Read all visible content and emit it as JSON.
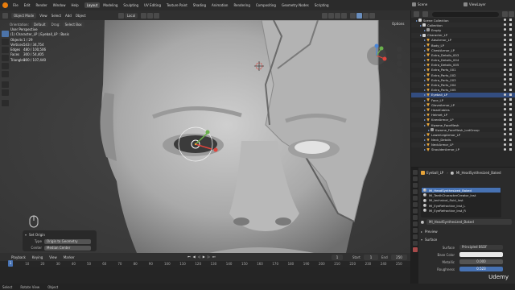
{
  "topbar": {
    "menus": [
      "File",
      "Edit",
      "Render",
      "Window",
      "Help"
    ],
    "workspaces": [
      {
        "label": "Layout",
        "active": true
      },
      {
        "label": "Modeling",
        "active": false
      },
      {
        "label": "Sculpting",
        "active": false
      },
      {
        "label": "UV Editing",
        "active": false
      },
      {
        "label": "Texture Paint",
        "active": false
      },
      {
        "label": "Shading",
        "active": false
      },
      {
        "label": "Animation",
        "active": false
      },
      {
        "label": "Rendering",
        "active": false
      },
      {
        "label": "Compositing",
        "active": false
      },
      {
        "label": "Geometry Nodes",
        "active": false
      },
      {
        "label": "Scripting",
        "active": false
      }
    ],
    "scene": "Scene",
    "view_layer": "ViewLayer"
  },
  "viewport_header": {
    "mode": "Object Mode",
    "menus": [
      "View",
      "Select",
      "Add",
      "Object"
    ],
    "transform": "Local",
    "orientation_label": "Orientation:",
    "orientation_value": "Default",
    "drag_label": "Drag:",
    "drag_value": "Select Box",
    "options": "Options"
  },
  "stats": {
    "perspective": "User Perspective",
    "object": "(1) Character_LP | Eyeball_LP : Basis",
    "rows": [
      {
        "key": "Objects",
        "value": "1 / 29"
      },
      {
        "key": "Vertices",
        "value": "543 / 34,754"
      },
      {
        "key": "Edges",
        "value": "480 / 100,506"
      },
      {
        "key": "Faces",
        "value": "300 / 54,405"
      },
      {
        "key": "Triangles",
        "value": "300 / 107,440"
      }
    ]
  },
  "last_operator": {
    "title": "Set Origin",
    "rows": [
      {
        "label": "Type",
        "value": "Origin to Geometry"
      },
      {
        "label": "Center",
        "value": "Median Center"
      }
    ]
  },
  "timeline": {
    "menus": [
      "Playback",
      "Keying",
      "View",
      "Marker"
    ],
    "current_frame": "1",
    "start_label": "Start",
    "start": "1",
    "end_label": "End",
    "end": "250",
    "ruler": [
      "0",
      "10",
      "20",
      "30",
      "40",
      "50",
      "60",
      "70",
      "80",
      "90",
      "100",
      "110",
      "120",
      "130",
      "140",
      "150",
      "160",
      "170",
      "180",
      "190",
      "200",
      "210",
      "220",
      "230",
      "240",
      "250"
    ]
  },
  "status": {
    "items": [
      "Select",
      "Rotate View",
      "Object"
    ]
  },
  "outliner": {
    "title": "Scene Collection",
    "rows": [
      {
        "label": "Scene Collection",
        "indent": 0,
        "kind": "collection"
      },
      {
        "label": "Collection",
        "indent": 1,
        "kind": "collection"
      },
      {
        "label": "Empty",
        "indent": 2,
        "kind": "empty"
      },
      {
        "label": "Character_LP",
        "indent": 1,
        "kind": "collection"
      },
      {
        "label": "AbsArmor_LP",
        "indent": 2,
        "kind": "mesh"
      },
      {
        "label": "Body_LP",
        "indent": 2,
        "kind": "mesh"
      },
      {
        "label": "ChestArmor_LP",
        "indent": 2,
        "kind": "mesh"
      },
      {
        "label": "Extra_Details_003",
        "indent": 2,
        "kind": "mesh"
      },
      {
        "label": "Extra_Details_004",
        "indent": 2,
        "kind": "mesh"
      },
      {
        "label": "Extra_Details_005",
        "indent": 2,
        "kind": "mesh"
      },
      {
        "label": "Extra_Parts_001",
        "indent": 2,
        "kind": "mesh"
      },
      {
        "label": "Extra_Parts_002",
        "indent": 2,
        "kind": "mesh"
      },
      {
        "label": "Extra_Parts_003",
        "indent": 2,
        "kind": "mesh"
      },
      {
        "label": "Extra_Parts_004",
        "indent": 2,
        "kind": "mesh"
      },
      {
        "label": "Extra_Parts_005",
        "indent": 2,
        "kind": "mesh"
      },
      {
        "label": "Eyeball_LP",
        "indent": 2,
        "kind": "mesh",
        "selected": true
      },
      {
        "label": "Face_LP",
        "indent": 2,
        "kind": "mesh"
      },
      {
        "label": "GloveArmor_LP",
        "indent": 2,
        "kind": "mesh"
      },
      {
        "label": "HeadCables",
        "indent": 2,
        "kind": "mesh"
      },
      {
        "label": "Helmet_LP",
        "indent": 2,
        "kind": "mesh"
      },
      {
        "label": "KneeArmor_LP",
        "indent": 2,
        "kind": "mesh"
      },
      {
        "label": "Kwame_FaceMesh",
        "indent": 2,
        "kind": "mesh"
      },
      {
        "label": "Kwame_FaceMesh_LodGroup",
        "indent": 3,
        "kind": "empty"
      },
      {
        "label": "LowerLegArmor_LP",
        "indent": 2,
        "kind": "mesh"
      },
      {
        "label": "Neck_Details",
        "indent": 2,
        "kind": "mesh"
      },
      {
        "label": "NeckArmor_LP",
        "indent": 2,
        "kind": "mesh"
      },
      {
        "label": "ShoulderArmor_LP",
        "indent": 2,
        "kind": "mesh"
      }
    ]
  },
  "properties": {
    "object_name": "Eyeball_LP",
    "material_name": "MI_HeadSynthesized_Baked",
    "slots": [
      {
        "label": "MI_HeadSynthesized_Baked",
        "selected": true
      },
      {
        "label": "MI_TeethCharacterCreator_Inst",
        "selected": false
      },
      {
        "label": "MI_technical_fluid_Inst",
        "selected": false
      },
      {
        "label": "MI_EyeRefractive_Inst_L",
        "selected": false
      },
      {
        "label": "MI_EyeRefractive_Inst_R",
        "selected": false
      }
    ],
    "active_material": "MI_HeadSynthesized_Baked",
    "preview_label": "Preview",
    "surface_section": "Surface",
    "fields": [
      {
        "label": "Surface",
        "value": "Principled BSDF",
        "style": "plain"
      },
      {
        "label": "Base Color",
        "value": "",
        "style": "white"
      },
      {
        "label": "Metallic",
        "value": "0.000",
        "style": "grey"
      },
      {
        "label": "Roughness",
        "value": "0.523",
        "style": "blue"
      }
    ]
  },
  "watermark": "Udemy",
  "colors": {
    "accent": "#4772b3",
    "selection": "#334d80",
    "gizmo_x": "#e0443c",
    "gizmo_y": "#6ab04c",
    "gizmo_z": "#4a86d8",
    "mesh_icon": "#e8a53a",
    "collection_icon": "#cfcfcf"
  }
}
